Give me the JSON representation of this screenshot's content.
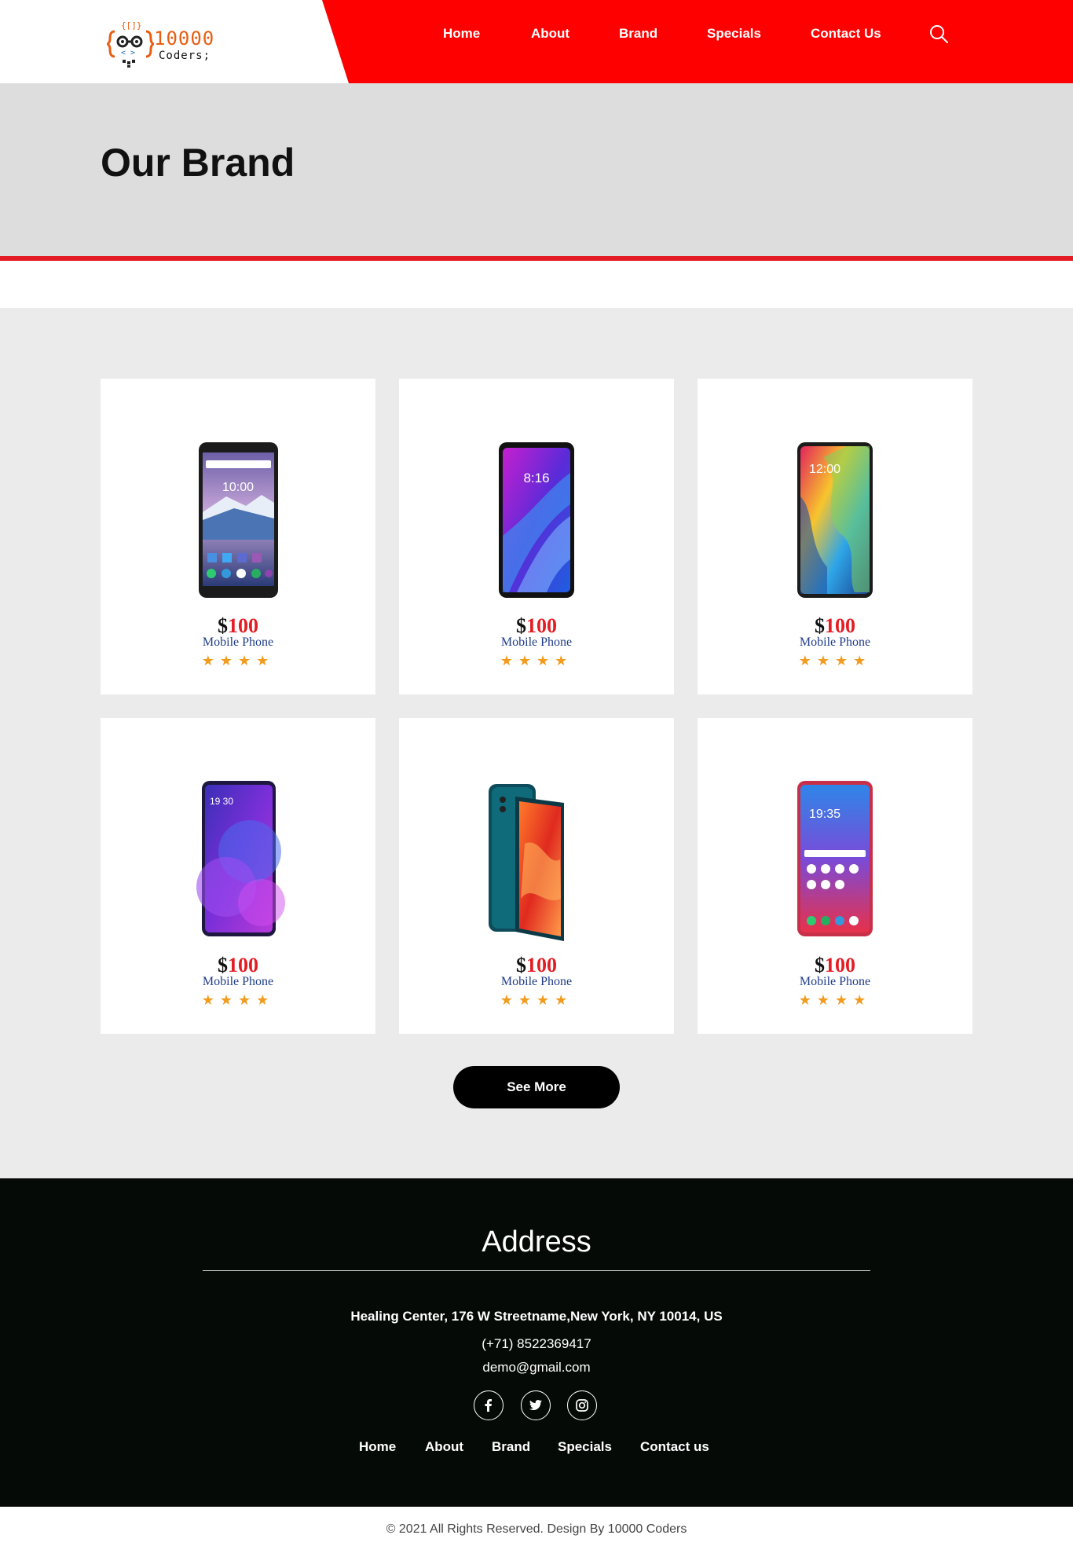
{
  "logo": {
    "number": "10000",
    "subtitle": "Coders;"
  },
  "nav": {
    "items": [
      "Home",
      "About",
      "Brand",
      "Specials",
      "Contact Us"
    ]
  },
  "page": {
    "title": "Our Brand"
  },
  "products": [
    {
      "currency": "$",
      "amount": "100",
      "label": "Mobile Phone",
      "rating": 4,
      "stars": "★★★★",
      "screen_text": "10:00"
    },
    {
      "currency": "$",
      "amount": "100",
      "label": "Mobile Phone",
      "rating": 4,
      "stars": "★★★★",
      "screen_text": "8:16"
    },
    {
      "currency": "$",
      "amount": "100",
      "label": "Mobile Phone",
      "rating": 4,
      "stars": "★★★★",
      "screen_text": "12:00"
    },
    {
      "currency": "$",
      "amount": "100",
      "label": "Mobile Phone",
      "rating": 4,
      "stars": "★★★★",
      "screen_text": "19 30"
    },
    {
      "currency": "$",
      "amount": "100",
      "label": "Mobile Phone",
      "rating": 4,
      "stars": "★★★★",
      "screen_text": ""
    },
    {
      "currency": "$",
      "amount": "100",
      "label": "Mobile Phone",
      "rating": 4,
      "stars": "★★★★",
      "screen_text": "19:35"
    }
  ],
  "see_more": "See More",
  "footer": {
    "heading": "Address",
    "address": "Healing Center, 176 W Streetname,New York, NY 10014, US",
    "phone": "(+71) 8522369417",
    "email": "demo@gmail.com",
    "social": [
      "facebook-icon",
      "twitter-icon",
      "instagram-icon"
    ],
    "links": [
      "Home",
      "About",
      "Brand",
      "Specials",
      "Contact us"
    ],
    "copyright": "© 2021 All Rights Reserved. Design By 10000 Coders"
  },
  "colors": {
    "accent": "#ff0000",
    "price": "#e41c23",
    "label": "#1f3c88",
    "star": "#f29c1f",
    "footer_bg": "#050a07"
  }
}
